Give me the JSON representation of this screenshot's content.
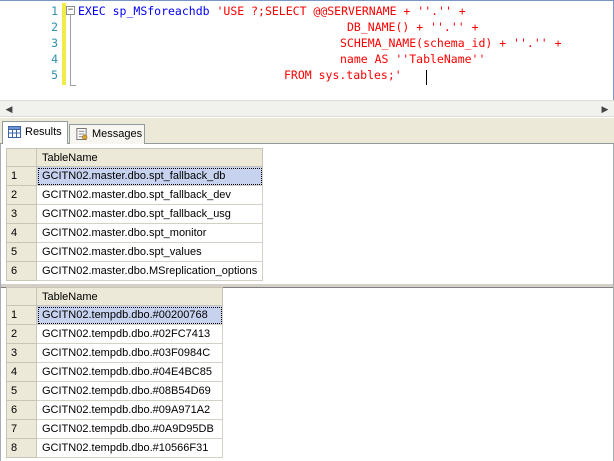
{
  "editor": {
    "line_numbers": [
      "1",
      "2",
      "3",
      "4",
      "5"
    ],
    "lines": [
      {
        "kw": "EXEC ",
        "name": "sp_MSforeachdb ",
        "str": "'USE ?;SELECT @@SERVERNAME + ''.'' +"
      },
      {
        "kw": "",
        "name": "",
        "str": "DB_NAME() + ''.'' +"
      },
      {
        "kw": "",
        "name": "",
        "str": "SCHEMA_NAME(schema_id) + ''.'' +"
      },
      {
        "kw": "",
        "name": "",
        "str": "name AS ''TableName''"
      },
      {
        "kw": "",
        "name": "",
        "str": "FROM sys.tables;'"
      }
    ]
  },
  "tabs": {
    "results": "Results",
    "messages": "Messages"
  },
  "result_sets": [
    {
      "column": "TableName",
      "rows": [
        {
          "n": "1",
          "v": "GCITN02.master.dbo.spt_fallback_db"
        },
        {
          "n": "2",
          "v": "GCITN02.master.dbo.spt_fallback_dev"
        },
        {
          "n": "3",
          "v": "GCITN02.master.dbo.spt_fallback_usg"
        },
        {
          "n": "4",
          "v": "GCITN02.master.dbo.spt_monitor"
        },
        {
          "n": "5",
          "v": "GCITN02.master.dbo.spt_values"
        },
        {
          "n": "6",
          "v": "GCITN02.master.dbo.MSreplication_options"
        }
      ]
    },
    {
      "column": "TableName",
      "rows": [
        {
          "n": "1",
          "v": "GCITN02.tempdb.dbo.#00200768"
        },
        {
          "n": "2",
          "v": "GCITN02.tempdb.dbo.#02FC7413"
        },
        {
          "n": "3",
          "v": "GCITN02.tempdb.dbo.#03F0984C"
        },
        {
          "n": "4",
          "v": "GCITN02.tempdb.dbo.#04E4BC85"
        },
        {
          "n": "5",
          "v": "GCITN02.tempdb.dbo.#08B54D69"
        },
        {
          "n": "6",
          "v": "GCITN02.tempdb.dbo.#09A971A2"
        },
        {
          "n": "7",
          "v": "GCITN02.tempdb.dbo.#0A9D95DB"
        },
        {
          "n": "8",
          "v": "GCITN02.tempdb.dbo.#10566F31"
        }
      ]
    }
  ],
  "colors": {
    "keyword": "#0000ff",
    "string": "#ff0000",
    "line_number": "#2b91af",
    "selection": "#c7d3ee",
    "change_bar": "#f2ec4a"
  },
  "icons": {
    "fold": "collapse-icon",
    "results_tab": "grid-icon",
    "messages_tab": "messages-icon",
    "scroll_left": "scroll-left-icon",
    "scroll_right": "scroll-right-icon"
  }
}
